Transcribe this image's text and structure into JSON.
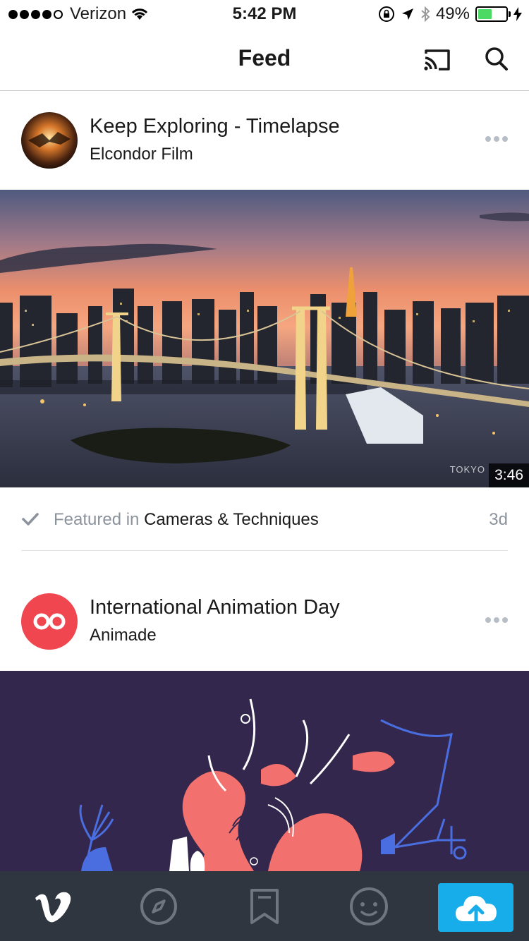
{
  "status_bar": {
    "carrier": "Verizon",
    "time": "5:42 PM",
    "battery_percent": "49%",
    "battery_level": 0.49,
    "signal_bars_filled": 4,
    "signal_bars_total": 5
  },
  "nav": {
    "title": "Feed"
  },
  "feed": [
    {
      "title": "Keep Exploring - Timelapse",
      "author": "Elcondor Film",
      "duration": "3:46",
      "watermark": "TOKYO",
      "featured_prefix": "Featured in",
      "featured_category": "Cameras & Techniques",
      "age": "3d"
    },
    {
      "title": "International Animation Day",
      "author": "Animade",
      "avatar_color": "#f0464f"
    }
  ],
  "tab_bar": {
    "tabs": [
      "vimeo-logo",
      "explore",
      "watch-later",
      "me"
    ],
    "upload_color": "#17adea"
  },
  "colors": {
    "tab_bar_bg": "#2f3640",
    "accent": "#17adea",
    "muted_text": "#8c939c"
  }
}
